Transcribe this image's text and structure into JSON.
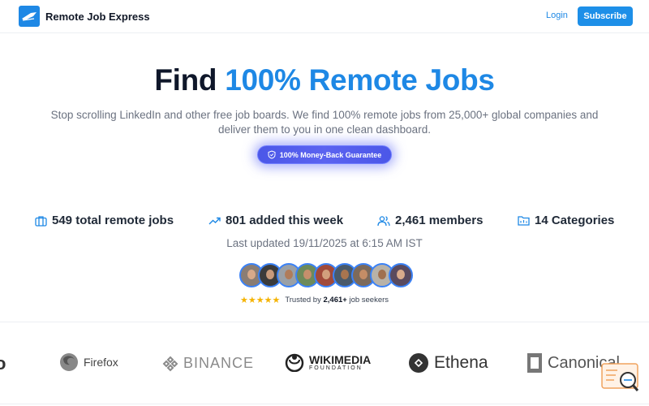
{
  "header": {
    "brand": "Remote Job Express",
    "login": "Login",
    "subscribe": "Subscribe"
  },
  "hero": {
    "title_part1": "Find ",
    "title_part2": "100% Remote Jobs",
    "subtitle": "Stop scrolling LinkedIn and other free job boards. We find 100% remote jobs from 25,000+ global companies and deliver them to you in one clean dashboard.",
    "guarantee": "100% Money-Back Guarantee"
  },
  "stats": [
    {
      "label": "549 total remote jobs",
      "icon": "briefcase-icon"
    },
    {
      "label": "801 added this week",
      "icon": "trending-up-icon"
    },
    {
      "label": "2,461 members",
      "icon": "users-icon"
    },
    {
      "label": "14 Categories",
      "icon": "folder-icon"
    }
  ],
  "updated": "Last updated 19/11/2025 at 6:15 AM IST",
  "social_proof": {
    "stars": "★★★★★",
    "prefix": "Trusted by ",
    "count": "2,461+",
    "suffix": " job seekers"
  },
  "logos": [
    {
      "name": "Firefox"
    },
    {
      "name": "BINANCE"
    },
    {
      "name": "WIKIMEDIA",
      "sub": "FOUNDATION"
    },
    {
      "name": "Ethena"
    },
    {
      "name": "Canonical"
    }
  ],
  "colors": {
    "accent": "#1e88e5",
    "guarantee_bg": "#4b57e8",
    "star": "#f5b301"
  }
}
